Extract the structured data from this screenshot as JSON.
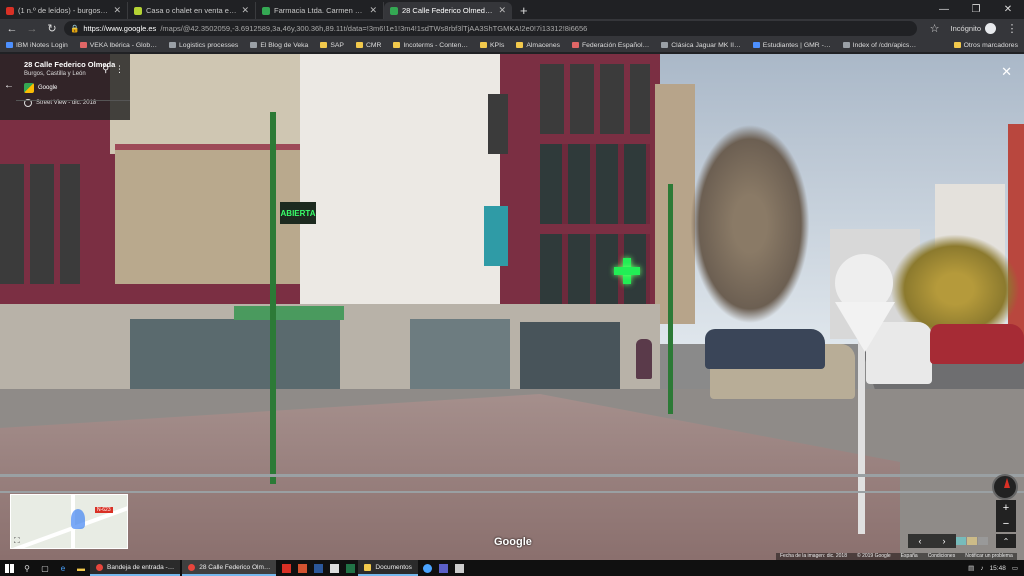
{
  "browser": {
    "tabs": [
      {
        "title": "(1 n.º de leídos) - burgos181…",
        "favicon_color": "#d93025",
        "active": false
      },
      {
        "title": "Casa o chalet en venta en calle …",
        "favicon_color": "#b5d334",
        "active": false
      },
      {
        "title": "Farmacia Ltda. Carmen Domingo…",
        "favicon_color": "#34a853",
        "active": false
      },
      {
        "title": "28 Calle Federico Olmeda - Goo…",
        "favicon_color": "#34a853",
        "active": true
      }
    ],
    "new_tab_label": "+",
    "url_host": "https://www.google.es",
    "url_path": "/maps/@42.3502059,-3.6912589,3a,46y,300.36h,89.11t/data=!3m6!1e1!3m4!1sdTWs8rbf3lTjAA3ShTGMKA!2e0!7i13312!8i6656",
    "incognito_label": "Incógnito",
    "bookmarks": [
      {
        "label": "IBM iNotes Login",
        "kind": "b"
      },
      {
        "label": "VEKA Ibérica - Glob…",
        "kind": "r"
      },
      {
        "label": "Logistics processes",
        "kind": "s"
      },
      {
        "label": "El Blog de Veka",
        "kind": "s"
      },
      {
        "label": "SAP",
        "kind": "f"
      },
      {
        "label": "CMR",
        "kind": "f"
      },
      {
        "label": "Incoterms - Conten…",
        "kind": "f"
      },
      {
        "label": "KPIs",
        "kind": "f"
      },
      {
        "label": "Almacenes",
        "kind": "f"
      },
      {
        "label": "Federación Español…",
        "kind": "r"
      },
      {
        "label": "Clásica Jaguar MK II…",
        "kind": "s"
      },
      {
        "label": "Estudiantes | GMR -…",
        "kind": "b"
      },
      {
        "label": "Index of /cdn/apics…",
        "kind": "s"
      }
    ],
    "other_bookmarks_label": "Otros marcadores"
  },
  "streetview": {
    "place_title": "28 Calle Federico Olmeda",
    "place_subtitle": "Burgos, Castilla y León",
    "provider": "Google",
    "capture_label": "Street View - dic. 2018",
    "watermark": "Google",
    "shop_sign_text": "ABIERTA",
    "credits": [
      "Fecha de la imagen: dic. 2018",
      "© 2019 Google",
      "España",
      "Condiciones",
      "Notificar un problema"
    ],
    "minimap_badge": "N-623"
  },
  "taskbar": {
    "apps": [
      {
        "label": "Bandeja de entrada -…",
        "icon": "chrome",
        "active": false
      },
      {
        "label": "28 Calle Federico Olm…",
        "icon": "chrome",
        "active": true
      },
      {
        "label": "Documentos",
        "icon": "folder",
        "active": false
      }
    ],
    "time": "15:48"
  }
}
